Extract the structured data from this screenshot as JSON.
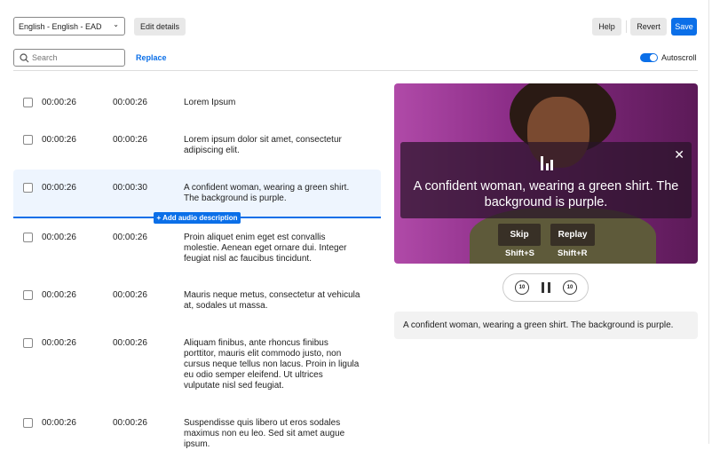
{
  "toolbar": {
    "language": "English - English - EAD",
    "edit_details": "Edit details",
    "help": "Help",
    "revert": "Revert",
    "save": "Save"
  },
  "search": {
    "placeholder": "Search",
    "replace": "Replace"
  },
  "autoscroll": {
    "label": "Autoscroll",
    "on": true
  },
  "rows": [
    {
      "start": "00:00:26",
      "end": "00:00:26",
      "text": "Lorem Ipsum"
    },
    {
      "start": "00:00:26",
      "end": "00:00:26",
      "text": "Lorem ipsum dolor sit amet, consectetur adipiscing elit."
    },
    {
      "start": "00:00:26",
      "end": "00:00:30",
      "text": "A confident woman, wearing a green shirt. The background is purple."
    },
    {
      "start": "00:00:26",
      "end": "00:00:26",
      "text": "Proin aliquet enim eget est convallis molestie. Aenean eget ornare dui. Integer feugiat nisl ac faucibus tincidunt."
    },
    {
      "start": "00:00:26",
      "end": "00:00:26",
      "text": "Mauris neque metus, consectetur at vehicula at, sodales ut massa."
    },
    {
      "start": "00:00:26",
      "end": "00:00:26",
      "text": "Aliquam finibus, ante rhoncus finibus porttitor, mauris elit commodo justo, non cursus neque tellus non lacus. Proin in ligula eu odio semper eleifend. Ut ultrices vulputate nisl sed feugiat."
    },
    {
      "start": "00:00:26",
      "end": "00:00:26",
      "text": "Suspendisse quis libero ut eros sodales maximus non eu leo. Sed sit amet augue ipsum."
    }
  ],
  "add_audio": "+ Add audio description",
  "video": {
    "overlay_text": "A confident woman, wearing a green shirt. The background is purple.",
    "skip": "Skip",
    "skip_shortcut": "Shift+S",
    "replay": "Replay",
    "replay_shortcut": "Shift+R"
  },
  "caption": "A confident woman, wearing a green shirt. The background is purple.",
  "colors": {
    "accent": "#0b6fe8",
    "selected_bg": "#eef5fe"
  }
}
